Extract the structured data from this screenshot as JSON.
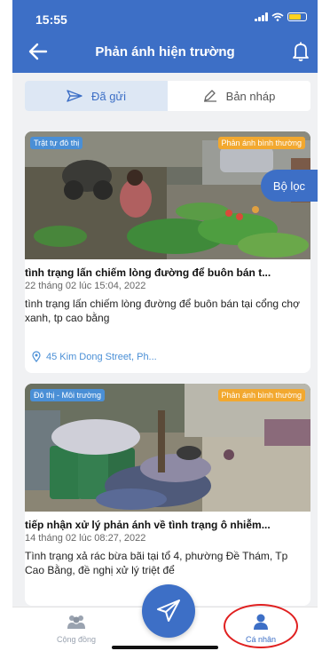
{
  "status": {
    "time": "15:55"
  },
  "header": {
    "title": "Phản ánh hiện trường"
  },
  "tabs": [
    {
      "label": "Đã gửi"
    },
    {
      "label": "Bản nháp"
    }
  ],
  "filter_button": {
    "label": "Bộ lọc"
  },
  "reports": [
    {
      "category_badge": "Trật tự đô thị",
      "type_badge": "Phản ánh bình thường",
      "title": "tình trạng lấn chiếm lòng đường để buôn bán t...",
      "date": "22 tháng 02 lúc 15:04, 2022",
      "description": "tình trạng lấn chiếm lòng đường để buôn bán tại cổng chợ xanh, tp cao bằng",
      "address": "45 Kim Dong Street, Ph..."
    },
    {
      "category_badge": "Đô thị - Môi trường",
      "type_badge": "Phản ánh bình thường",
      "title": "tiếp nhận xử lý phản ánh về tình trạng ô nhiễm...",
      "date": "14 tháng 02 lúc 08:27, 2022",
      "description": "Tình trạng xả rác bừa bãi tại tổ 4, phường Đề Thám, Tp Cao Bằng, đề nghị xử lý triệt để"
    }
  ],
  "bottom_nav": [
    {
      "label": "Cộng đồng",
      "icon": "people-icon"
    },
    {
      "label": "Cá nhân",
      "icon": "person-icon"
    }
  ],
  "colors": {
    "primary": "#3d6fc6",
    "badge_blue": "#4a8fd6",
    "badge_orange": "#f2a82f",
    "highlight": "#e02020"
  }
}
